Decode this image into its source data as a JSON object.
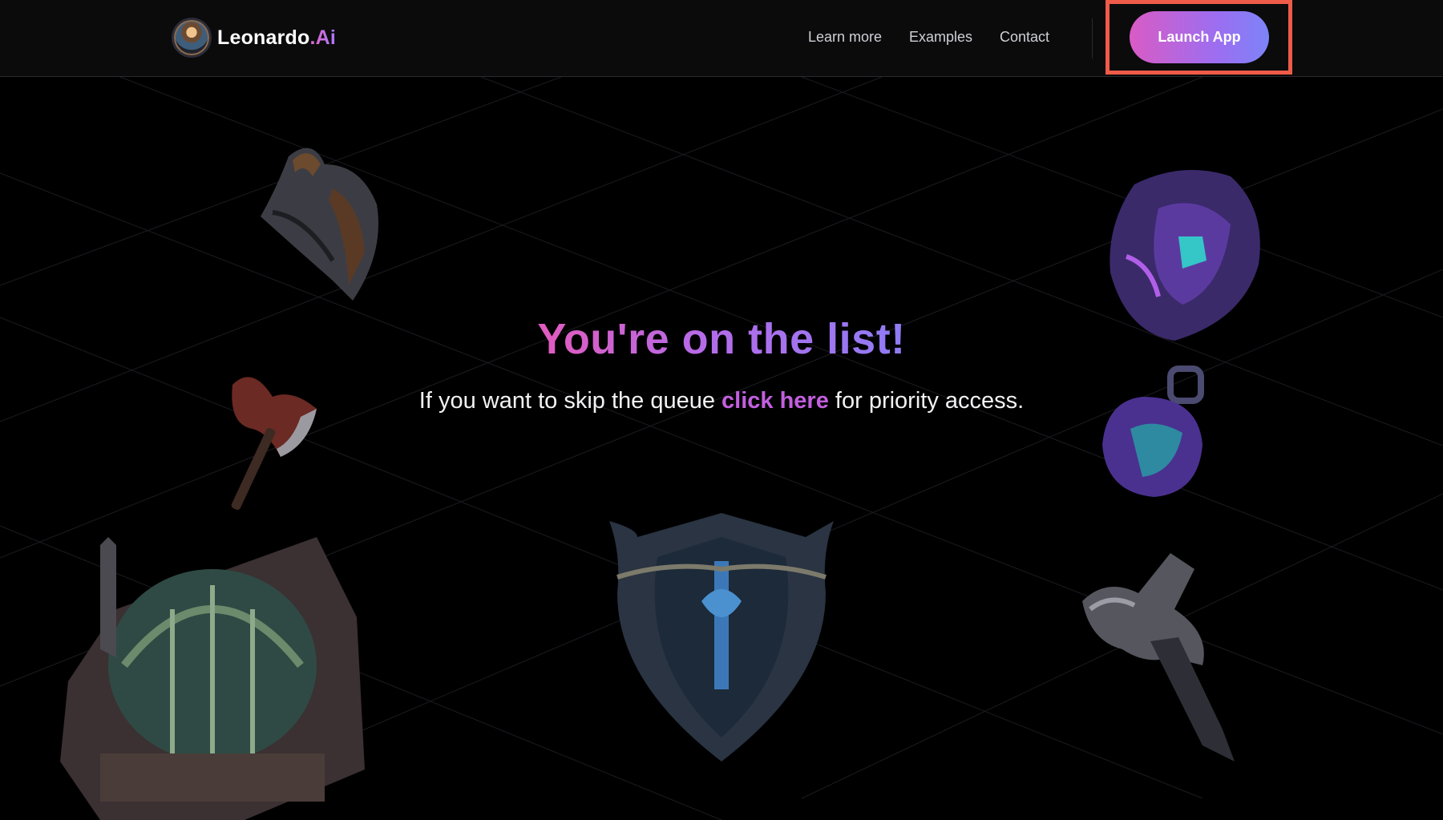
{
  "header": {
    "brand_name": "Leonardo",
    "brand_dot": ".",
    "brand_suffix": "Ai",
    "nav": [
      "Learn more",
      "Examples",
      "Contact"
    ],
    "launch_label": "Launch App"
  },
  "hero": {
    "title": "You're on the list!",
    "sub_before": "If you want to skip the queue ",
    "sub_link": "click here",
    "sub_after": " for priority access."
  },
  "colors": {
    "accent_pink": "#e25bbd",
    "accent_violet": "#8f7cf5",
    "highlight_box": "#ef5b49",
    "background": "#000000"
  },
  "icons": {
    "logo": "leonardo-avatar-icon",
    "art": [
      "horned-helmet-icon",
      "battle-axe-icon",
      "reactor-dome-icon",
      "ornate-shield-icon",
      "crystal-gauntlet-icon",
      "potion-grenade-icon",
      "war-hammer-icon"
    ]
  }
}
